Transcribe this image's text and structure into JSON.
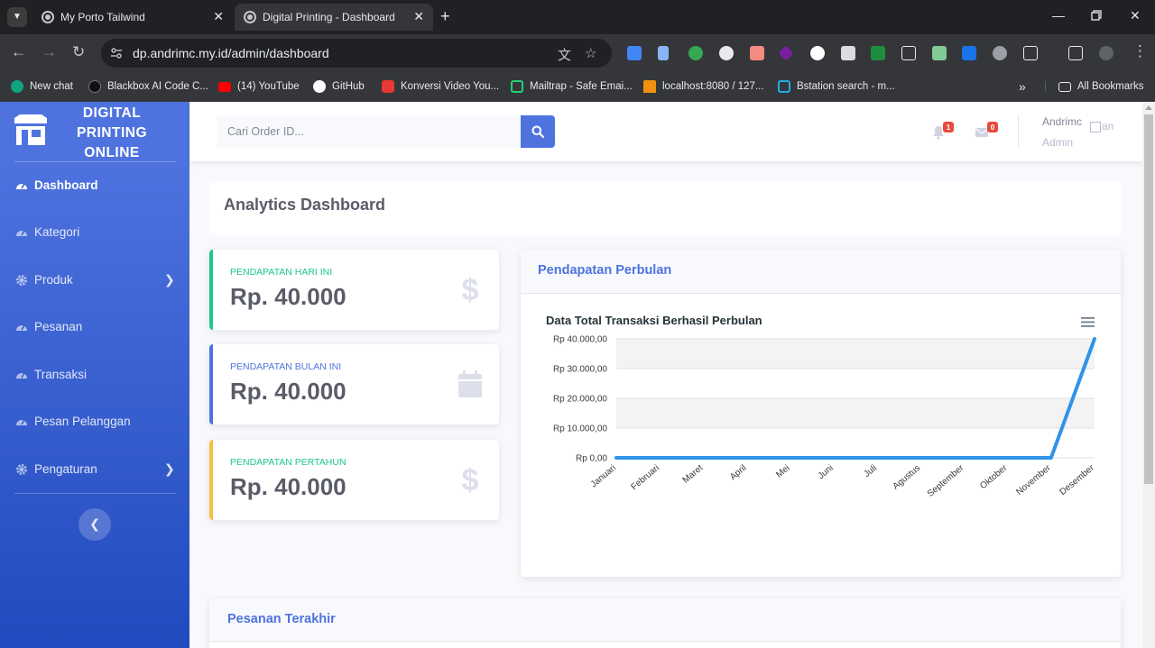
{
  "browser": {
    "tabs": [
      {
        "title": "My Porto Tailwind",
        "active": false
      },
      {
        "title": "Digital Printing - Dashboard",
        "active": true
      }
    ],
    "url": "dp.andrimc.my.id/admin/dashboard",
    "bookmarks": [
      {
        "label": "New chat",
        "icon": "openai-icon",
        "color": "#10a37f"
      },
      {
        "label": "Blackbox AI Code C...",
        "icon": "blackbox-icon",
        "color": "#111111"
      },
      {
        "label": "(14) YouTube",
        "icon": "youtube-icon",
        "color": "#ff0000"
      },
      {
        "label": "GitHub",
        "icon": "github-icon",
        "color": "#ffffff"
      },
      {
        "label": "Konversi Video You...",
        "icon": "download-icon",
        "color": "#e53935"
      },
      {
        "label": "Mailtrap - Safe Emai...",
        "icon": "mailtrap-icon",
        "color": "#22d172"
      },
      {
        "label": "localhost:8080 / 127...",
        "icon": "phpmyadmin-icon",
        "color": "#f29111"
      },
      {
        "label": "Bstation search - m...",
        "icon": "bilibili-icon",
        "color": "#23ade5"
      }
    ],
    "all_bookmarks": "All Bookmarks"
  },
  "sidebar": {
    "brand": {
      "line1": "DIGITAL",
      "line2": "PRINTING",
      "line3": "ONLINE"
    },
    "items": [
      {
        "label": "Dashboard",
        "icon": "tachometer-icon",
        "active": true,
        "has_submenu": false
      },
      {
        "label": "Kategori",
        "icon": "tachometer-icon",
        "active": false,
        "has_submenu": false
      },
      {
        "label": "Produk",
        "icon": "gear-icon",
        "active": false,
        "has_submenu": true
      },
      {
        "label": "Pesanan",
        "icon": "tachometer-icon",
        "active": false,
        "has_submenu": false
      },
      {
        "label": "Transaksi",
        "icon": "tachometer-icon",
        "active": false,
        "has_submenu": false
      },
      {
        "label": "Pesan Pelanggan",
        "icon": "tachometer-icon",
        "active": false,
        "has_submenu": false
      },
      {
        "label": "Pengaturan",
        "icon": "gear-icon",
        "active": false,
        "has_submenu": true
      }
    ]
  },
  "topbar": {
    "search_placeholder": "Cari Order ID...",
    "alerts_count": "1",
    "messages_count": "0",
    "user_name": "Andrimc",
    "user_role": "Admin",
    "avatar_alt": "an"
  },
  "main": {
    "page_title": "Analytics Dashboard",
    "stats": [
      {
        "label": "PENDAPATAN HARI INI",
        "value": "Rp. 40.000",
        "accent": "#1cc88a",
        "icon": "dollar-icon"
      },
      {
        "label": "PENDAPATAN BULAN INI",
        "value": "Rp. 40.000",
        "accent": "#4e73df",
        "icon": "calendar-icon"
      },
      {
        "label": "PENDAPATAN PERTAHUN",
        "value": "Rp. 40.000",
        "accent": "#f6c23e",
        "icon": "dollar-icon"
      }
    ],
    "chart_card_title": "Pendapatan Perbulan",
    "recent_card_title": "Pesanan Terakhir"
  },
  "chart_data": {
    "type": "line",
    "title": "Data Total Transaksi Berhasil Perbulan",
    "categories": [
      "Januari",
      "Februari",
      "Maret",
      "April",
      "Mei",
      "Juni",
      "Juli",
      "Agustus",
      "September",
      "Oktober",
      "November",
      "Desember"
    ],
    "series": [
      {
        "values": [
          0,
          0,
          0,
          0,
          0,
          0,
          0,
          0,
          0,
          0,
          0,
          40000
        ]
      }
    ],
    "ylim": [
      0,
      40000
    ],
    "yticks": [
      0,
      10000,
      20000,
      30000,
      40000
    ],
    "ytick_labels": [
      "Rp 0,00",
      "Rp 10.000,00",
      "Rp 20.000,00",
      "Rp 30.000,00",
      "Rp 40.000,00"
    ],
    "grid": true,
    "line_color": "#2e93e8",
    "menu_icon": "hamburger-icon"
  }
}
